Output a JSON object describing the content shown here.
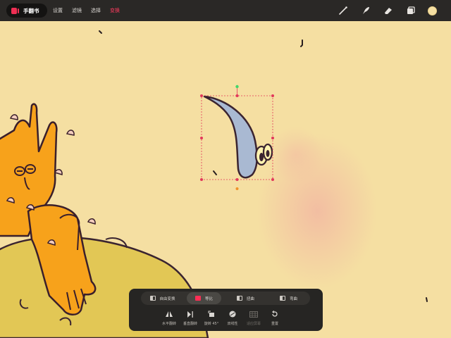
{
  "app": {
    "name": "手翻书",
    "logo_color": "#ef2f53"
  },
  "menu": [
    {
      "label": "设置",
      "active": false
    },
    {
      "label": "滤镜",
      "active": false
    },
    {
      "label": "选择",
      "active": false
    },
    {
      "label": "变换",
      "active": true
    }
  ],
  "toolbar": {
    "icons": [
      "brush-icon",
      "smudge-icon",
      "eraser-icon",
      "layers-icon"
    ],
    "current_color": "#f5dfa2"
  },
  "transform_panel": {
    "modes": [
      {
        "label": "自由变换",
        "active": false
      },
      {
        "label": "等比",
        "active": true
      },
      {
        "label": "扭曲",
        "active": false
      },
      {
        "label": "弯曲",
        "active": false
      }
    ],
    "actions": [
      {
        "label": "水平翻转",
        "icon": "flip-horizontal-icon",
        "enabled": true
      },
      {
        "label": "垂直翻转",
        "icon": "flip-vertical-icon",
        "enabled": true
      },
      {
        "label": "旋转 45°",
        "icon": "rotate-45-icon",
        "enabled": true
      },
      {
        "label": "双线性",
        "icon": "bilinear-icon",
        "enabled": true
      },
      {
        "label": "适应屏幕",
        "icon": "grid-icon",
        "enabled": false
      },
      {
        "label": "重置",
        "icon": "reset-icon",
        "enabled": true
      }
    ]
  },
  "colors": {
    "canvas_bg": "#f5dfa2",
    "accent": "#ff2e55",
    "bar": "#2a2826"
  }
}
